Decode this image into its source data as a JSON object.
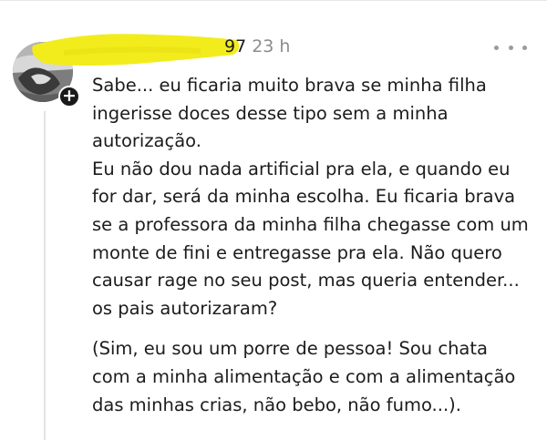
{
  "comment": {
    "author_visible": "97",
    "timestamp": "23 h",
    "more_icon": "more-horizontal-icon",
    "expand_icon": "plus-icon",
    "paragraphs": [
      "Sabe... eu ficaria muito brava se minha filha\ningerisse doces desse tipo sem a minha\nautorização.\nEu não dou nada artificial pra ela, e quando eu\nfor dar, será da minha escolha. Eu ficaria brava\nse a professora da minha filha chegasse com um\nmonte de fini e entregasse pra ela. Não quero\ncausar rage no seu post, mas queria entender...\nos pais autorizaram?",
      "(Sim, eu sou um porre de pessoa! Sou chata\ncom a minha alimentação e com a alimentação\ndas minhas crias, não bebo, não fumo...)."
    ]
  },
  "colors": {
    "redaction_highlight": "#f2ec1c",
    "timestamp_gray": "#8c8c8c",
    "thread_line": "#e3e3e3"
  }
}
